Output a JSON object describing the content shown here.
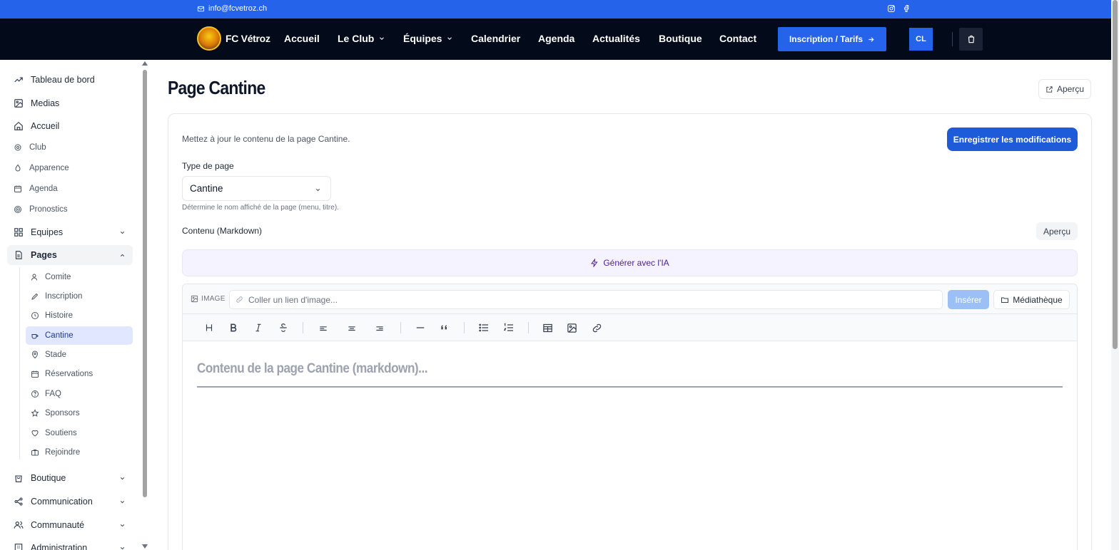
{
  "topbar": {
    "email": "info@fcvetroz.ch"
  },
  "nav": {
    "brand": "FC Vétroz",
    "items": [
      {
        "label": "Accueil",
        "dropdown": false
      },
      {
        "label": "Le Club",
        "dropdown": true
      },
      {
        "label": "Équipes",
        "dropdown": true
      },
      {
        "label": "Calendrier",
        "dropdown": false
      },
      {
        "label": "Agenda",
        "dropdown": false
      },
      {
        "label": "Actualités",
        "dropdown": false
      },
      {
        "label": "Boutique",
        "dropdown": false
      },
      {
        "label": "Contact",
        "dropdown": false
      }
    ],
    "cta": "Inscription / Tarifs",
    "avatar": "CL"
  },
  "sidebar": {
    "items": [
      {
        "label": "Tableau de bord",
        "icon": "trending-icon"
      },
      {
        "label": "Medias",
        "icon": "image-icon"
      },
      {
        "label": "Accueil",
        "icon": "home-icon"
      },
      {
        "label": "Club",
        "icon": "gear-icon"
      },
      {
        "label": "Apparence",
        "icon": "drop-icon"
      },
      {
        "label": "Agenda",
        "icon": "calendar-icon"
      },
      {
        "label": "Pronostics",
        "icon": "target-icon"
      },
      {
        "label": "Equipes",
        "icon": "grid-icon"
      },
      {
        "label": "Pages",
        "icon": "file-icon"
      }
    ],
    "pages_sub": [
      {
        "label": "Comite",
        "icon": "user-icon"
      },
      {
        "label": "Inscription",
        "icon": "pen-icon"
      },
      {
        "label": "Histoire",
        "icon": "clock-icon"
      },
      {
        "label": "Cantine",
        "icon": "cup-icon"
      },
      {
        "label": "Stade",
        "icon": "pin-icon"
      },
      {
        "label": "Réservations",
        "icon": "calendar-icon"
      },
      {
        "label": "FAQ",
        "icon": "help-icon"
      },
      {
        "label": "Sponsors",
        "icon": "star-icon"
      },
      {
        "label": "Soutiens",
        "icon": "heart-icon"
      },
      {
        "label": "Rejoindre",
        "icon": "briefcase-icon"
      }
    ],
    "bottom": [
      {
        "label": "Boutique",
        "icon": "bag-icon"
      },
      {
        "label": "Communication",
        "icon": "share-icon"
      },
      {
        "label": "Communauté",
        "icon": "users-icon"
      },
      {
        "label": "Administration",
        "icon": "building-icon"
      }
    ]
  },
  "main": {
    "title": "Page Cantine",
    "preview": "Aperçu",
    "description": "Mettez à jour le contenu de la page Cantine.",
    "save": "Enregistrer les modifications",
    "page_type_label": "Type de page",
    "page_type_value": "Cantine",
    "page_type_hint": "Détermine le nom affiché de la page (menu, titre).",
    "content_label": "Contenu (Markdown)",
    "content_preview": "Aperçu",
    "ai_button": "Générer avec l'IA",
    "image_tag": "IMAGE",
    "image_placeholder": "Coller un lien d'image...",
    "insert": "Insérer",
    "media_library": "Médiathèque",
    "editor_placeholder": "Contenu de la page Cantine (markdown)..."
  }
}
